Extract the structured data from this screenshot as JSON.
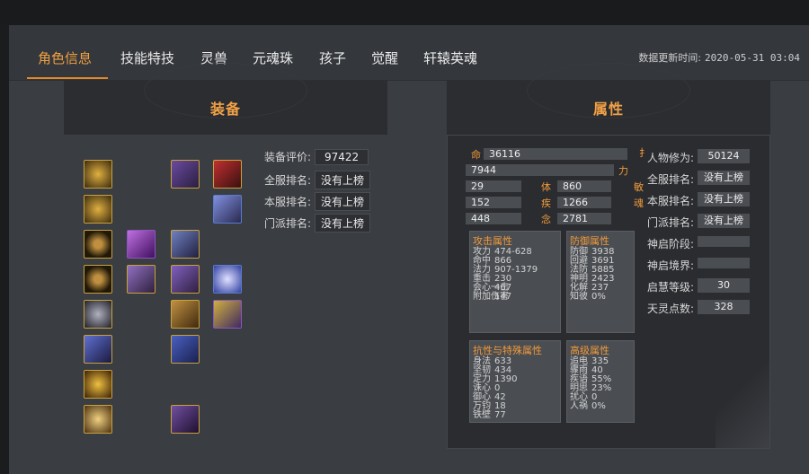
{
  "tabs": [
    "角色信息",
    "技能特技",
    "灵兽",
    "元魂珠",
    "孩子",
    "觉醒",
    "轩辕英魂"
  ],
  "update": {
    "label": "数据更新时间:",
    "value": "2020-05-31 03:04"
  },
  "equip": {
    "title": "装备",
    "score_label": "装备评价:",
    "score": "97422",
    "all_rank_label": "全服排名:",
    "all_rank": "没有上榜",
    "server_rank_label": "本服排名:",
    "server_rank": "没有上榜",
    "sect_rank_label": "门派排名:",
    "sect_rank": "没有上榜"
  },
  "attr": {
    "title": "属性",
    "hp_label": "命",
    "hp": "36116",
    "mp": "7944",
    "power_label": "力",
    "a": "29",
    "ti_label": "体",
    "ti": "860",
    "b": "152",
    "ji_label": "疾",
    "ji": "1266",
    "c": "448",
    "nian_label": "念",
    "nian": "2781",
    "side_labels": [
      "扌",
      "敏",
      "魂"
    ],
    "cultivation_label": "人物修为:",
    "cultivation": "50124",
    "all_rank_label": "全服排名:",
    "all_rank": "没有上榜",
    "server_rank_label": "本服排名:",
    "server_rank": "没有上榜",
    "sect_rank_label": "门派排名:",
    "sect_rank": "没有上榜",
    "tq_stage_label": "神启阶段:",
    "tq_stage": "",
    "tq_realm_label": "神启境界:",
    "tq_realm": "",
    "enlight_label": "启慧等级:",
    "enlight": "30",
    "tianling_label": "天灵点数:",
    "tianling": "328",
    "attack": {
      "title": "攻击属性",
      "rows": [
        [
          "攻力",
          "474-628"
        ],
        [
          "命中",
          "866"
        ],
        [
          "法力",
          "907-1379"
        ],
        [
          "重击",
          "230"
        ],
        [
          "会心一击",
          "467"
        ],
        [
          "附加伤害",
          "147"
        ]
      ]
    },
    "defense": {
      "title": "防御属性",
      "rows": [
        [
          "防御",
          "3938"
        ],
        [
          "回避",
          "3691"
        ],
        [
          "法防",
          "5885"
        ],
        [
          "神明",
          "2423"
        ],
        [
          "化解",
          "237"
        ],
        [
          "知彼",
          "0%"
        ]
      ]
    },
    "resist": {
      "title": "抗性与特殊属性",
      "rows": [
        [
          "身法",
          "633"
        ],
        [
          "坚韧",
          "434"
        ],
        [
          "定力",
          "1390"
        ],
        [
          "诛心",
          "0"
        ],
        [
          "御心",
          "42"
        ],
        [
          "万钧",
          "18"
        ],
        [
          "铁壁",
          "77"
        ]
      ]
    },
    "advanced": {
      "title": "高级属性",
      "rows": [
        [
          "追电",
          "335"
        ],
        [
          "骤雨",
          "40"
        ],
        [
          "疾语",
          "55%"
        ],
        [
          "明思",
          "23%"
        ],
        [
          "扰心",
          "0"
        ],
        [
          "人祸",
          "0%"
        ]
      ]
    }
  },
  "slots": [
    {
      "id": "slot-1",
      "color": "#c9a23c"
    },
    {
      "id": "slot-2",
      "color": "#8a56c0"
    },
    {
      "id": "slot-3",
      "color": "#c9a23c"
    },
    {
      "id": "slot-4",
      "color": "#c9a23c"
    },
    {
      "id": "slot-5",
      "color": "#5a7ad0"
    }
  ]
}
